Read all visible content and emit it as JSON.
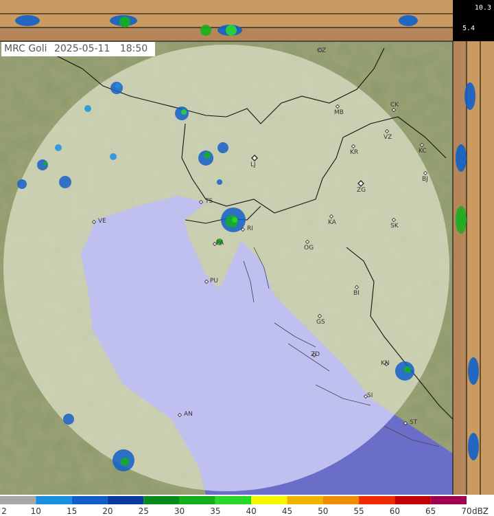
{
  "header": {
    "radar_name": "MRC Goli",
    "date": "2025-05-11",
    "time": "18:50"
  },
  "profile": {
    "top_value": "10.3",
    "mid_value": "5.4"
  },
  "cities": [
    {
      "code": "GZ"
    },
    {
      "code": "MB"
    },
    {
      "code": "CK"
    },
    {
      "code": "VZ"
    },
    {
      "code": "KR"
    },
    {
      "code": "KC"
    },
    {
      "code": "LJ"
    },
    {
      "code": "BJ"
    },
    {
      "code": "ZG"
    },
    {
      "code": "TS"
    },
    {
      "code": "VE"
    },
    {
      "code": "RI"
    },
    {
      "code": "KA"
    },
    {
      "code": "SK"
    },
    {
      "code": "PA"
    },
    {
      "code": "OG"
    },
    {
      "code": "PU"
    },
    {
      "code": "BI"
    },
    {
      "code": "GS"
    },
    {
      "code": "ZD"
    },
    {
      "code": "KN"
    },
    {
      "code": "SI"
    },
    {
      "code": "AN"
    },
    {
      "code": "ST"
    }
  ],
  "legend": {
    "unit": "dBZ",
    "ticks": [
      "2",
      "10",
      "15",
      "20",
      "25",
      "30",
      "35",
      "40",
      "45",
      "50",
      "55",
      "60",
      "65",
      "70"
    ],
    "colors": [
      "#a8a8a8",
      "#1a90e0",
      "#1060c8",
      "#0a3aa0",
      "#0a8a1a",
      "#14b01c",
      "#2ad82a",
      "#f6f600",
      "#f0b400",
      "#f08c00",
      "#f02a00",
      "#c00000",
      "#a00050",
      "#800090"
    ]
  }
}
